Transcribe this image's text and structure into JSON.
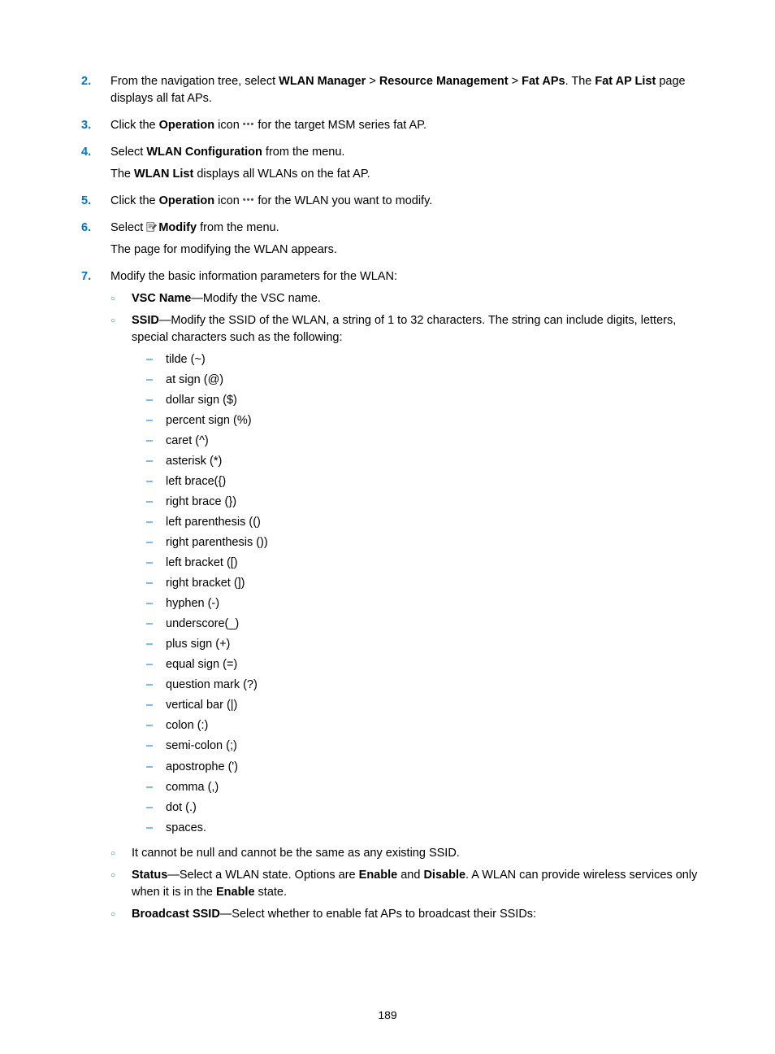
{
  "steps": {
    "s2": {
      "num": "2.",
      "text_pre": "From the navigation tree, select ",
      "b1": "WLAN Manager",
      "gt1": " > ",
      "b2": "Resource Management",
      "gt2": " > ",
      "b3": "Fat APs",
      "text_mid": ". The ",
      "b4": "Fat AP List",
      "text_post": " page displays all fat APs."
    },
    "s3": {
      "num": "3.",
      "t1": "Click the ",
      "b1": "Operation",
      "t2": " icon ",
      "t3": " for the target MSM series fat AP."
    },
    "s4": {
      "num": "4.",
      "t1": "Select ",
      "b1": "WLAN Configuration",
      "t2": " from the menu.",
      "p2a": "The ",
      "p2b": "WLAN List",
      "p2c": " displays all WLANs on the fat AP."
    },
    "s5": {
      "num": "5.",
      "t1": "Click the ",
      "b1": "Operation",
      "t2": " icon ",
      "t3": " for the WLAN you want to modify."
    },
    "s6": {
      "num": "6.",
      "t1": "Select ",
      "b1": "Modify",
      "t2": " from the menu.",
      "p2": "The page for modifying the WLAN appears."
    },
    "s7": {
      "num": "7.",
      "t1": "Modify the basic information parameters for the WLAN:"
    }
  },
  "sub": {
    "vsc": {
      "b": "VSC Name",
      "t": "—Modify the VSC name."
    },
    "ssid": {
      "b": "SSID",
      "t": "—Modify the SSID of the WLAN, a string of 1 to 32 characters. The string can include digits, letters, special characters such as the following:"
    },
    "notnull": "It cannot be null and cannot be the same as any existing SSID.",
    "status": {
      "b": "Status",
      "t1": "—Select a WLAN state. Options are ",
      "b2": "Enable",
      "t2": " and ",
      "b3": "Disable",
      "t3": ". A WLAN can provide wireless services only when it is in the ",
      "b4": "Enable",
      "t4": " state."
    },
    "bcast": {
      "b": "Broadcast SSID",
      "t": "—Select whether to enable fat APs to broadcast their SSIDs:"
    }
  },
  "dashes": [
    "tilde (~)",
    "at sign (@)",
    "dollar sign ($)",
    "percent sign (%)",
    "caret (^)",
    "asterisk (*)",
    "left brace({)",
    "right brace (})",
    "left parenthesis (()",
    "right parenthesis ())",
    "left bracket ([)",
    "right bracket (])",
    "hyphen (-)",
    "underscore(_)",
    "plus sign (+)",
    "equal sign (=)",
    "question mark (?)",
    "vertical bar (|)",
    "colon (:)",
    "semi-colon (;)",
    "apostrophe (')",
    "comma (,)",
    "dot (.)",
    "spaces."
  ],
  "dash_bullet": "–",
  "circ_bullet": "○",
  "dots_icon": "•••",
  "page_number": "189"
}
